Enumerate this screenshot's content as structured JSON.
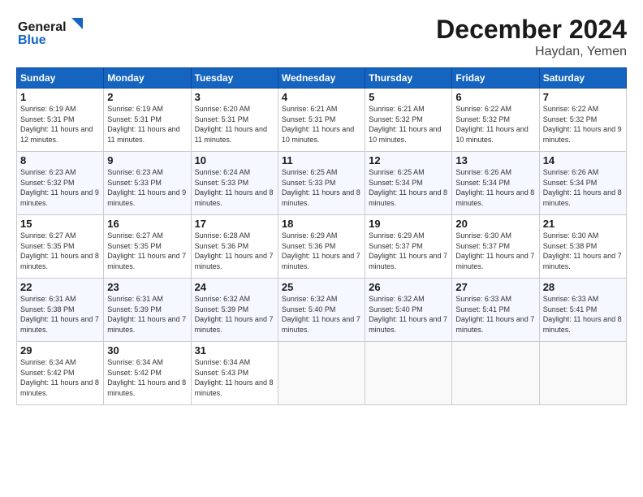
{
  "logo": {
    "line1": "General",
    "line2": "Blue"
  },
  "header": {
    "month": "December 2024",
    "location": "Haydan, Yemen"
  },
  "weekdays": [
    "Sunday",
    "Monday",
    "Tuesday",
    "Wednesday",
    "Thursday",
    "Friday",
    "Saturday"
  ],
  "weeks": [
    [
      {
        "day": "1",
        "sunrise": "6:19 AM",
        "sunset": "5:31 PM",
        "daylight": "11 hours and 12 minutes."
      },
      {
        "day": "2",
        "sunrise": "6:19 AM",
        "sunset": "5:31 PM",
        "daylight": "11 hours and 11 minutes."
      },
      {
        "day": "3",
        "sunrise": "6:20 AM",
        "sunset": "5:31 PM",
        "daylight": "11 hours and 11 minutes."
      },
      {
        "day": "4",
        "sunrise": "6:21 AM",
        "sunset": "5:31 PM",
        "daylight": "11 hours and 10 minutes."
      },
      {
        "day": "5",
        "sunrise": "6:21 AM",
        "sunset": "5:32 PM",
        "daylight": "11 hours and 10 minutes."
      },
      {
        "day": "6",
        "sunrise": "6:22 AM",
        "sunset": "5:32 PM",
        "daylight": "11 hours and 10 minutes."
      },
      {
        "day": "7",
        "sunrise": "6:22 AM",
        "sunset": "5:32 PM",
        "daylight": "11 hours and 9 minutes."
      }
    ],
    [
      {
        "day": "8",
        "sunrise": "6:23 AM",
        "sunset": "5:32 PM",
        "daylight": "11 hours and 9 minutes."
      },
      {
        "day": "9",
        "sunrise": "6:23 AM",
        "sunset": "5:33 PM",
        "daylight": "11 hours and 9 minutes."
      },
      {
        "day": "10",
        "sunrise": "6:24 AM",
        "sunset": "5:33 PM",
        "daylight": "11 hours and 8 minutes."
      },
      {
        "day": "11",
        "sunrise": "6:25 AM",
        "sunset": "5:33 PM",
        "daylight": "11 hours and 8 minutes."
      },
      {
        "day": "12",
        "sunrise": "6:25 AM",
        "sunset": "5:34 PM",
        "daylight": "11 hours and 8 minutes."
      },
      {
        "day": "13",
        "sunrise": "6:26 AM",
        "sunset": "5:34 PM",
        "daylight": "11 hours and 8 minutes."
      },
      {
        "day": "14",
        "sunrise": "6:26 AM",
        "sunset": "5:34 PM",
        "daylight": "11 hours and 8 minutes."
      }
    ],
    [
      {
        "day": "15",
        "sunrise": "6:27 AM",
        "sunset": "5:35 PM",
        "daylight": "11 hours and 8 minutes."
      },
      {
        "day": "16",
        "sunrise": "6:27 AM",
        "sunset": "5:35 PM",
        "daylight": "11 hours and 7 minutes."
      },
      {
        "day": "17",
        "sunrise": "6:28 AM",
        "sunset": "5:36 PM",
        "daylight": "11 hours and 7 minutes."
      },
      {
        "day": "18",
        "sunrise": "6:29 AM",
        "sunset": "5:36 PM",
        "daylight": "11 hours and 7 minutes."
      },
      {
        "day": "19",
        "sunrise": "6:29 AM",
        "sunset": "5:37 PM",
        "daylight": "11 hours and 7 minutes."
      },
      {
        "day": "20",
        "sunrise": "6:30 AM",
        "sunset": "5:37 PM",
        "daylight": "11 hours and 7 minutes."
      },
      {
        "day": "21",
        "sunrise": "6:30 AM",
        "sunset": "5:38 PM",
        "daylight": "11 hours and 7 minutes."
      }
    ],
    [
      {
        "day": "22",
        "sunrise": "6:31 AM",
        "sunset": "5:38 PM",
        "daylight": "11 hours and 7 minutes."
      },
      {
        "day": "23",
        "sunrise": "6:31 AM",
        "sunset": "5:39 PM",
        "daylight": "11 hours and 7 minutes."
      },
      {
        "day": "24",
        "sunrise": "6:32 AM",
        "sunset": "5:39 PM",
        "daylight": "11 hours and 7 minutes."
      },
      {
        "day": "25",
        "sunrise": "6:32 AM",
        "sunset": "5:40 PM",
        "daylight": "11 hours and 7 minutes."
      },
      {
        "day": "26",
        "sunrise": "6:32 AM",
        "sunset": "5:40 PM",
        "daylight": "11 hours and 7 minutes."
      },
      {
        "day": "27",
        "sunrise": "6:33 AM",
        "sunset": "5:41 PM",
        "daylight": "11 hours and 7 minutes."
      },
      {
        "day": "28",
        "sunrise": "6:33 AM",
        "sunset": "5:41 PM",
        "daylight": "11 hours and 8 minutes."
      }
    ],
    [
      {
        "day": "29",
        "sunrise": "6:34 AM",
        "sunset": "5:42 PM",
        "daylight": "11 hours and 8 minutes."
      },
      {
        "day": "30",
        "sunrise": "6:34 AM",
        "sunset": "5:42 PM",
        "daylight": "11 hours and 8 minutes."
      },
      {
        "day": "31",
        "sunrise": "6:34 AM",
        "sunset": "5:43 PM",
        "daylight": "11 hours and 8 minutes."
      },
      null,
      null,
      null,
      null
    ]
  ],
  "labels": {
    "sunrise": "Sunrise:",
    "sunset": "Sunset:",
    "daylight": "Daylight:"
  }
}
